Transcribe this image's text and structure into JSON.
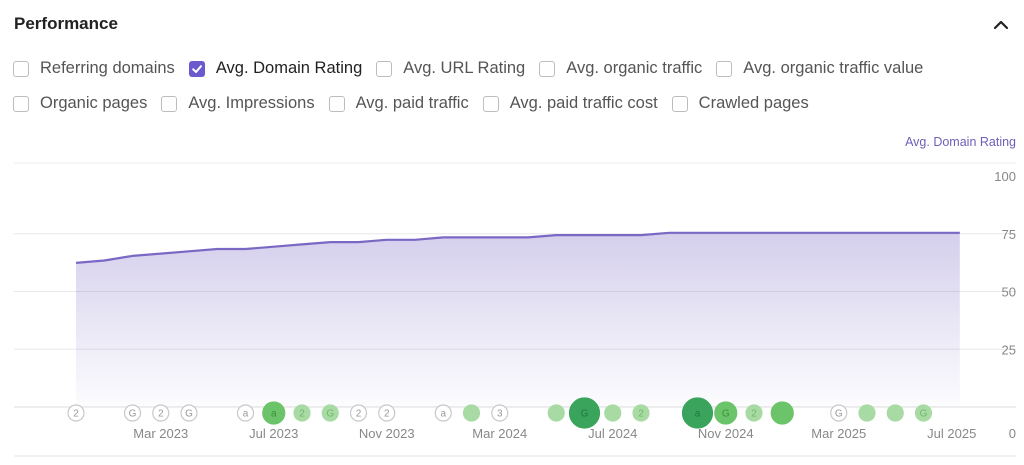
{
  "panel": {
    "title": "Performance",
    "collapse_icon": "chevron-up-icon"
  },
  "metrics_row1": [
    {
      "label": "Referring domains",
      "checked": false
    },
    {
      "label": "Avg. Domain Rating",
      "checked": true
    },
    {
      "label": "Avg. URL Rating",
      "checked": false
    },
    {
      "label": "Avg. organic traffic",
      "checked": false
    },
    {
      "label": "Avg. organic traffic value",
      "checked": false
    }
  ],
  "metrics_row2": [
    {
      "label": "Organic pages",
      "checked": false
    },
    {
      "label": "Avg. Impressions",
      "checked": false
    },
    {
      "label": "Avg. paid traffic",
      "checked": false
    },
    {
      "label": "Avg. paid traffic cost",
      "checked": false
    },
    {
      "label": "Crawled pages",
      "checked": false
    }
  ],
  "colors": {
    "accent": "#6a5acd",
    "line": "#7a68c4",
    "event_green": "#4caf50"
  },
  "chart_data": {
    "type": "area",
    "series_title": "Avg. Domain Rating",
    "x_tick_labels": [
      "Mar 2023",
      "Jul 2023",
      "Nov 2023",
      "Mar 2024",
      "Jul 2024",
      "Nov 2024",
      "Mar 2025",
      "Jul 2025"
    ],
    "y_ticks": [
      0,
      25,
      50,
      75,
      100
    ],
    "ylim": [
      0,
      100
    ],
    "x_range": [
      "2022-11",
      "2025-07"
    ],
    "grid": true,
    "series": [
      {
        "name": "Avg. Domain Rating",
        "x": [
          "2022-12",
          "2023-01",
          "2023-02",
          "2023-03",
          "2023-04",
          "2023-05",
          "2023-06",
          "2023-07",
          "2023-08",
          "2023-09",
          "2023-10",
          "2023-11",
          "2023-12",
          "2024-01",
          "2024-02",
          "2024-03",
          "2024-04",
          "2024-05",
          "2024-06",
          "2024-07",
          "2024-08",
          "2024-09",
          "2024-10",
          "2024-11",
          "2024-12",
          "2025-01",
          "2025-02",
          "2025-03",
          "2025-04",
          "2025-05",
          "2025-06",
          "2025-07"
        ],
        "values": [
          65,
          66,
          68,
          69,
          70,
          71,
          71,
          72,
          73,
          74,
          74,
          75,
          75,
          76,
          76,
          76,
          76,
          77,
          77,
          77,
          77,
          78,
          78,
          78,
          78,
          78,
          78,
          78,
          78,
          78,
          78,
          78
        ]
      }
    ],
    "events": [
      {
        "x": "2022-12",
        "label": "2",
        "size": "small",
        "style": "outline"
      },
      {
        "x": "2023-02",
        "label": "G",
        "size": "small",
        "style": "outline"
      },
      {
        "x": "2023-03",
        "label": "2",
        "size": "small",
        "style": "outline"
      },
      {
        "x": "2023-04",
        "label": "G",
        "size": "small",
        "style": "outline"
      },
      {
        "x": "2023-06",
        "label": "a",
        "size": "small",
        "style": "outline"
      },
      {
        "x": "2023-07",
        "label": "a",
        "size": "medium",
        "style": "green"
      },
      {
        "x": "2023-08",
        "label": "2",
        "size": "small",
        "style": "light"
      },
      {
        "x": "2023-09",
        "label": "G",
        "size": "small",
        "style": "light"
      },
      {
        "x": "2023-10",
        "label": "2",
        "size": "small",
        "style": "outline"
      },
      {
        "x": "2023-11",
        "label": "2",
        "size": "small",
        "style": "outline"
      },
      {
        "x": "2024-01",
        "label": "a",
        "size": "small",
        "style": "outline"
      },
      {
        "x": "2024-02",
        "label": "",
        "size": "small",
        "style": "light"
      },
      {
        "x": "2024-03",
        "label": "3",
        "size": "small",
        "style": "outline"
      },
      {
        "x": "2024-05",
        "label": "",
        "size": "small",
        "style": "light"
      },
      {
        "x": "2024-06",
        "label": "G",
        "size": "large",
        "style": "dark"
      },
      {
        "x": "2024-07",
        "label": "",
        "size": "small",
        "style": "light"
      },
      {
        "x": "2024-08",
        "label": "2",
        "size": "small",
        "style": "light"
      },
      {
        "x": "2024-10",
        "label": "a",
        "size": "large",
        "style": "dark"
      },
      {
        "x": "2024-11",
        "label": "G",
        "size": "medium",
        "style": "green"
      },
      {
        "x": "2024-12",
        "label": "2",
        "size": "small",
        "style": "light"
      },
      {
        "x": "2025-01",
        "label": "",
        "size": "medium",
        "style": "green"
      },
      {
        "x": "2025-03",
        "label": "G",
        "size": "small",
        "style": "outline"
      },
      {
        "x": "2025-04",
        "label": "",
        "size": "small",
        "style": "light"
      },
      {
        "x": "2025-05",
        "label": "",
        "size": "small",
        "style": "light"
      },
      {
        "x": "2025-06",
        "label": "G",
        "size": "small",
        "style": "light"
      }
    ]
  }
}
